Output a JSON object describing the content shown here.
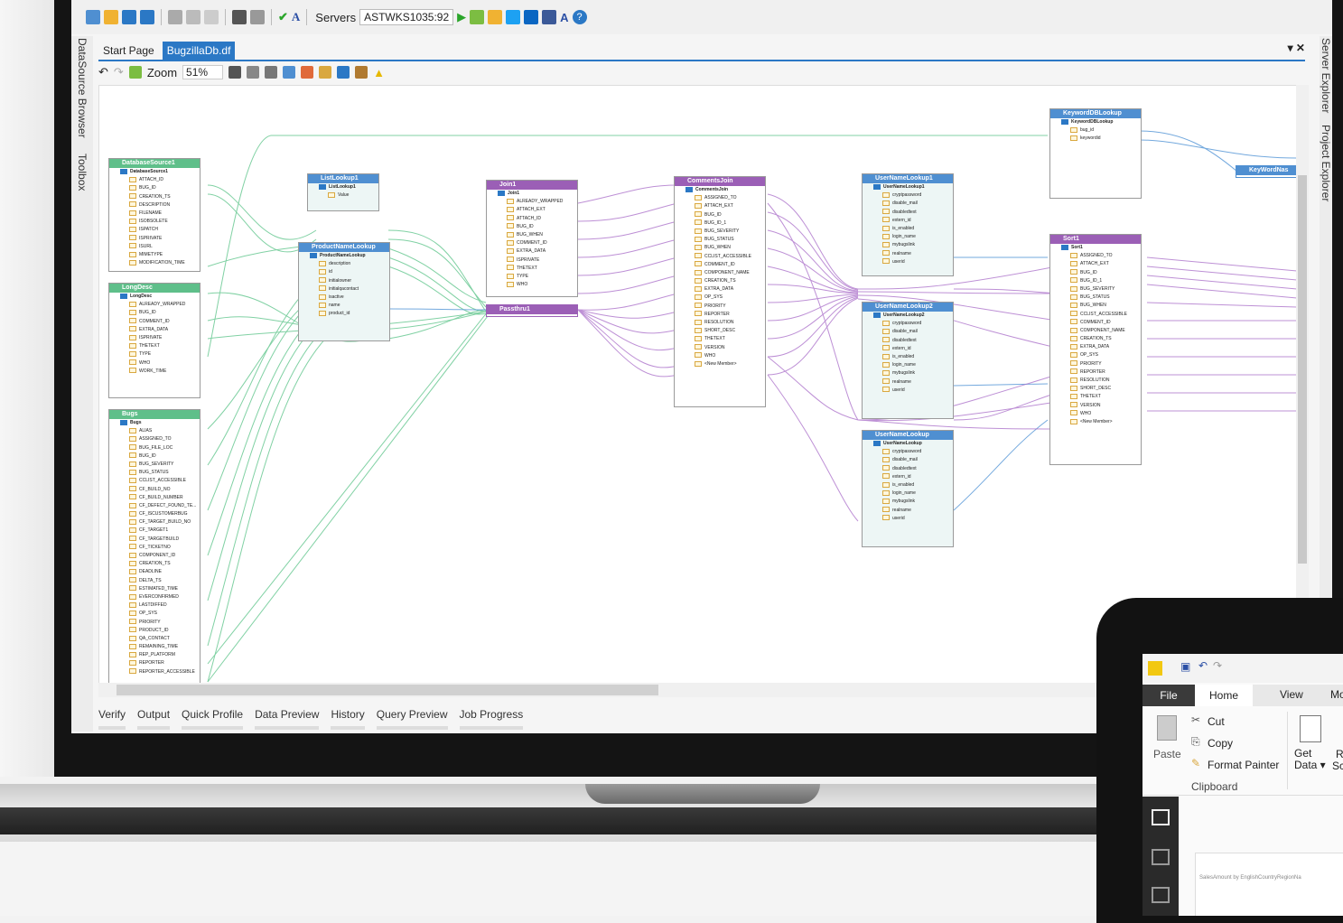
{
  "toolbar": {
    "servers_label": "Servers",
    "server_value": "ASTWKS1035:92"
  },
  "side_panels": {
    "left": [
      "DataSource Browser",
      "Toolbox"
    ],
    "right": [
      "Server Explorer",
      "Project Explorer"
    ]
  },
  "tabs": [
    {
      "label": "Start Page",
      "active": false
    },
    {
      "label": "BugzillaDb.df",
      "active": true
    }
  ],
  "tab_controls": "▾ ✕",
  "zoom": {
    "label": "Zoom",
    "value": "51%"
  },
  "bottom_tabs": [
    "Verify",
    "Output",
    "Quick Profile",
    "Data Preview",
    "History",
    "Query Preview",
    "Job Progress"
  ],
  "nodes": {
    "datasource1": {
      "title": "DatabaseSource1",
      "root": "DatabaseSource1",
      "fields": [
        "ATTACH_ID",
        "BUG_ID",
        "CREATION_TS",
        "DESCRIPTION",
        "FILENAME",
        "ISOBSOLETE",
        "ISPATCH",
        "ISPRIVATE",
        "ISURL",
        "MIMETYPE",
        "MODIFICATION_TIME"
      ]
    },
    "longdesc": {
      "title": "LongDesc",
      "root": "LongDesc",
      "fields": [
        "ALREADY_WRAPPED",
        "BUG_ID",
        "COMMENT_ID",
        "EXTRA_DATA",
        "ISPRIVATE",
        "THETEXT",
        "TYPE",
        "WHO",
        "WORK_TIME"
      ]
    },
    "bugs": {
      "title": "Bugs",
      "root": "Bugs",
      "fields": [
        "ALIAS",
        "ASSIGNED_TO",
        "BUG_FILE_LOC",
        "BUG_ID",
        "BUG_SEVERITY",
        "BUG_STATUS",
        "CCLIST_ACCESSIBLE",
        "CF_BUILD_NO",
        "CF_BUILD_NUMBER",
        "CF_DEFECT_FOUND_TE...",
        "CF_ISCUSTOMERBUG",
        "CF_TARGET_BUILD_NO",
        "CF_TARGET1",
        "CF_TARGETBUILD",
        "CF_TICKETNO",
        "COMPONENT_ID",
        "CREATION_TS",
        "DEADLINE",
        "DELTA_TS",
        "ESTIMATED_TIME",
        "EVERCONFIRMED",
        "LASTDIFFED",
        "OP_SYS",
        "PRIORITY",
        "PRODUCT_ID",
        "QA_CONTACT",
        "REMAINING_TIME",
        "REP_PLATFORM",
        "REPORTER",
        "REPORTER_ACCESSIBLE"
      ]
    },
    "listlookup1": {
      "title": "ListLookup1",
      "root": "ListLookup1",
      "fields": [
        "Value"
      ]
    },
    "productnamelookup": {
      "title": "ProductNameLookup",
      "root": "ProductNameLookup",
      "fields": [
        "description",
        "id",
        "initialowner",
        "initialqacontact",
        "isactive",
        "name",
        "product_id"
      ]
    },
    "join1": {
      "title": "Join1",
      "root": "Join1",
      "fields": [
        "ALREADY_WRAPPED",
        "ATTACH_EXT",
        "ATTACH_ID",
        "BUG_ID",
        "BUG_WHEN",
        "COMMENT_ID",
        "EXTRA_DATA",
        "ISPRIVATE",
        "THETEXT",
        "TYPE",
        "WHO"
      ]
    },
    "passthru1": {
      "title": "Passthru1"
    },
    "commentsjoin": {
      "title": "CommentsJoin",
      "root": "CommentsJoin",
      "fields": [
        "ASSIGNED_TO",
        "ATTACH_EXT",
        "BUG_ID",
        "BUG_ID_1",
        "BUG_SEVERITY",
        "BUG_STATUS",
        "BUG_WHEN",
        "CCLIST_ACCESSIBLE",
        "COMMENT_ID",
        "COMPONENT_NAME",
        "CREATION_TS",
        "EXTRA_DATA",
        "OP_SYS",
        "PRIORITY",
        "REPORTER",
        "RESOLUTION",
        "SHORT_DESC",
        "THETEXT",
        "VERSION",
        "WHO",
        "<New Member>"
      ]
    },
    "usernamelookup1": {
      "title": "UserNameLookup1",
      "root": "UserNameLookup1",
      "fields": [
        "cryptpassword",
        "disable_mail",
        "disabledtext",
        "extern_id",
        "is_enabled",
        "login_name",
        "mybugslink",
        "realname",
        "userid"
      ]
    },
    "usernamelookup2": {
      "title": "UserNameLookup2",
      "root": "UserNameLookup2",
      "fields": [
        "cryptpassword",
        "disable_mail",
        "disabledtext",
        "extern_id",
        "is_enabled",
        "login_name",
        "mybugslink",
        "realname",
        "userid"
      ]
    },
    "usernamelookup": {
      "title": "UserNameLookup",
      "root": "UserNameLookup",
      "fields": [
        "cryptpassword",
        "disable_mail",
        "disabledtext",
        "extern_id",
        "is_enabled",
        "login_name",
        "mybugslink",
        "realname",
        "userid"
      ]
    },
    "keyworddblookup": {
      "title": "KeywordDBLookup",
      "root": "KeywordDBLookup",
      "fields": [
        "bug_id",
        "keywordid"
      ]
    },
    "keywordnas": {
      "title": "KeyWordNas"
    },
    "sort1": {
      "title": "Sort1",
      "root": "Sort1",
      "fields": [
        "ASSIGNED_TO",
        "ATTACH_EXT",
        "BUG_ID",
        "BUG_ID_1",
        "BUG_SEVERITY",
        "BUG_STATUS",
        "BUG_WHEN",
        "CCLIST_ACCESSIBLE",
        "COMMENT_ID",
        "COMPONENT_NAME",
        "CREATION_TS",
        "EXTRA_DATA",
        "OP_SYS",
        "PRIORITY",
        "REPORTER",
        "RESOLUTION",
        "SHORT_DESC",
        "THETEXT",
        "VERSION",
        "WHO",
        "<New Member>"
      ]
    }
  },
  "tablet": {
    "tabs": [
      "File",
      "Home",
      "View",
      "Mo"
    ],
    "clipboard": {
      "paste": "Paste",
      "cut": "Cut",
      "copy": "Copy",
      "format_painter": "Format Painter",
      "group": "Clipboard"
    },
    "get_data": "Get Data ▾",
    "r_label": "R",
    "sc_label": "Sc",
    "card_title": "SalesAmount by EnglishCountryRegionNa"
  }
}
